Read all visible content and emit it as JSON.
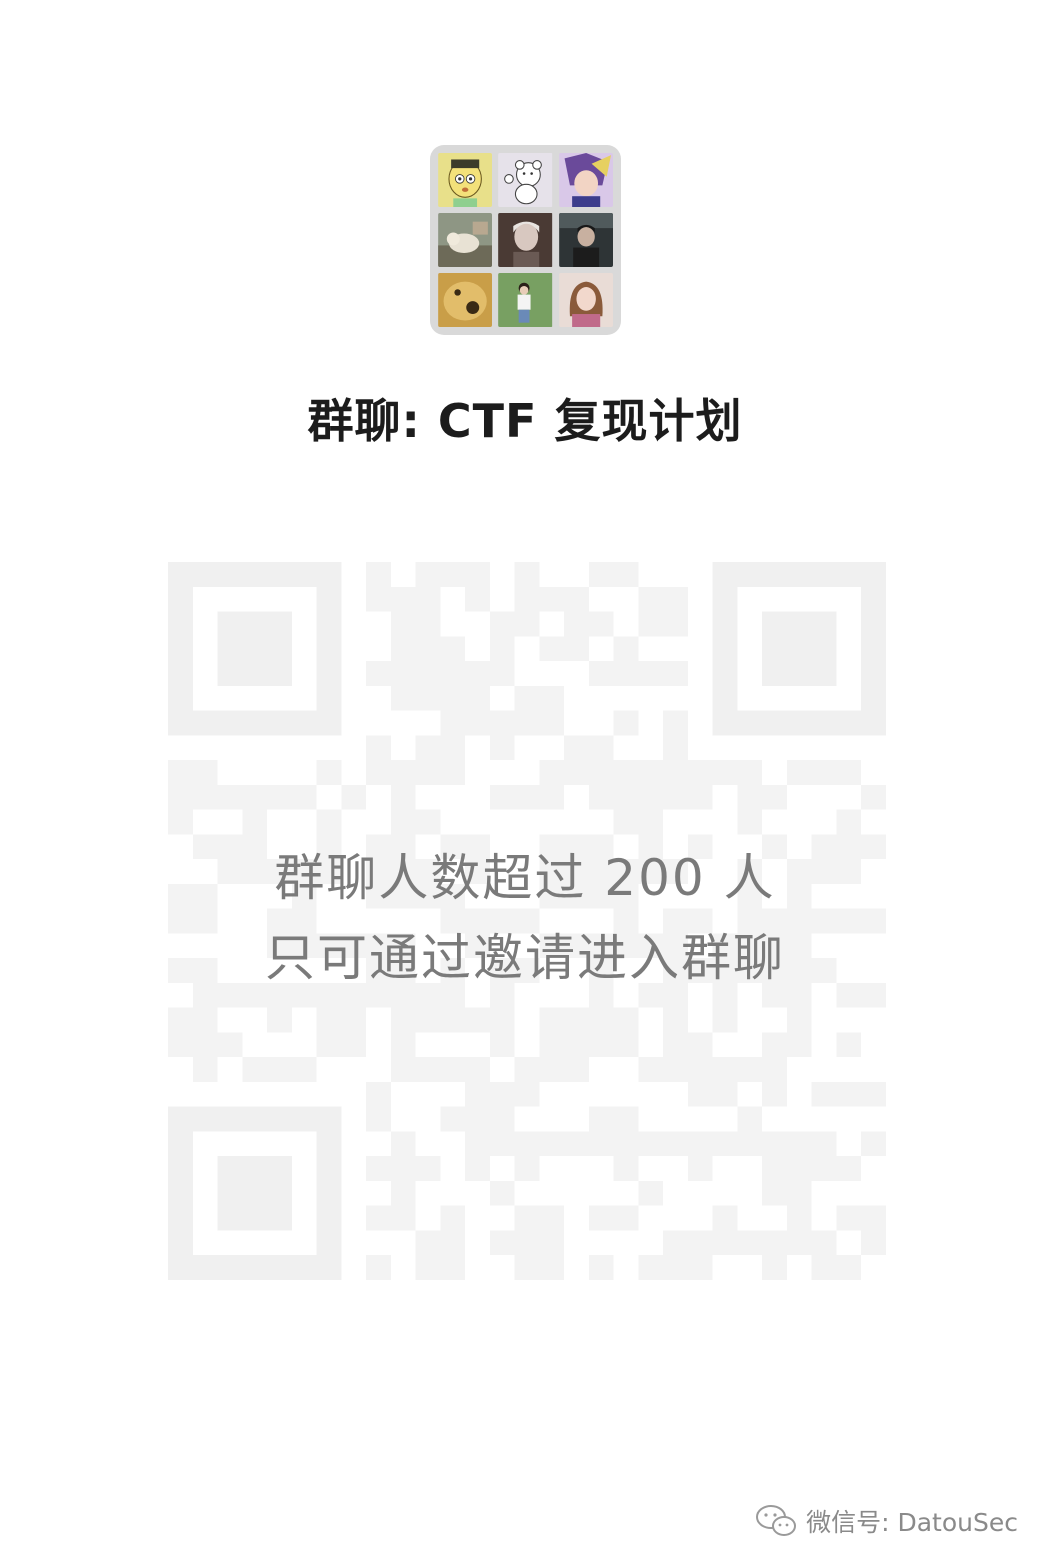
{
  "group": {
    "title": "群聊: CTF 复现计划",
    "avatar_tiles": [
      {
        "icon": "cartoon-boy-avatar",
        "color": "#e8e08a"
      },
      {
        "icon": "cartoon-bear-avatar",
        "color": "#e6e2ea"
      },
      {
        "icon": "anime-character-avatar",
        "color": "#c4a8d8"
      },
      {
        "icon": "cat-photo-avatar",
        "color": "#9aa08c"
      },
      {
        "icon": "person-portrait-avatar",
        "color": "#5a4a42"
      },
      {
        "icon": "person-dark-avatar",
        "color": "#3a3a3a"
      },
      {
        "icon": "plush-toy-avatar",
        "color": "#d7b25c"
      },
      {
        "icon": "girl-on-grass-avatar",
        "color": "#7fa36a"
      },
      {
        "icon": "anime-girl-avatar",
        "color": "#d8b8b0"
      }
    ]
  },
  "qr": {
    "notice_line1": "群聊人数超过 200 人",
    "notice_line2": "只可通过邀请进入群聊"
  },
  "watermark": {
    "icon": "wechat-icon",
    "text": "微信号: DatouSec"
  }
}
